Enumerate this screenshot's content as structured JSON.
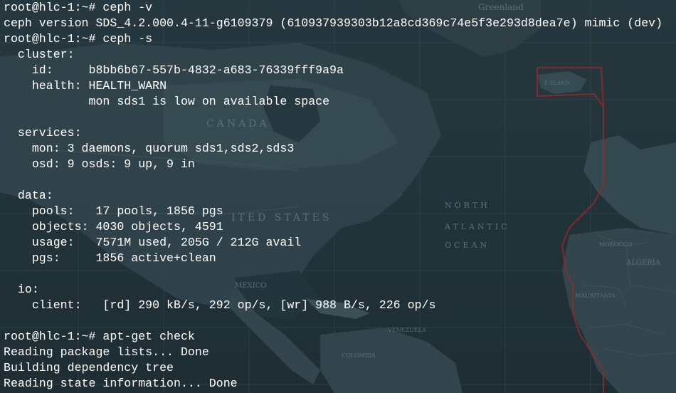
{
  "terminal": {
    "lines": [
      "root@hlc-1:~# ceph -v",
      "ceph version SDS_4.2.000.4-11-g6109379 (610937939303b12a8cd369c74e5f3e293d8dea7e) mimic (dev)",
      "root@hlc-1:~# ceph -s",
      "  cluster:",
      "    id:     b8bb6b67-557b-4832-a683-76339fff9a9a",
      "    health: HEALTH_WARN",
      "            mon sds1 is low on available space",
      "",
      "  services:",
      "    mon: 3 daemons, quorum sds1,sds2,sds3",
      "    osd: 9 osds: 9 up, 9 in",
      "",
      "  data:",
      "    pools:   17 pools, 1856 pgs",
      "    objects: 4030 objects, 4591",
      "    usage:   7571M used, 205G / 212G avail",
      "    pgs:     1856 active+clean",
      "",
      "  io:",
      "    client:   [rd] 290 kB/s, 292 op/s, [wr] 988 B/s, 226 op/s",
      "",
      "root@hlc-1:~# apt-get check",
      "Reading package lists... Done",
      "Building dependency tree",
      "Reading state information... Done"
    ]
  },
  "background_map": {
    "labels": {
      "greenland": "Greenland",
      "canada": "CANADA",
      "united_states": "ITED STATES",
      "north": "NORTH",
      "atlantic": "ATLANTIC",
      "ocean": "OCEAN",
      "mexico": "MEXICO",
      "algeria": "ALGERIA",
      "morocco": "MOROCCO",
      "mauritania": "MAURITANIA",
      "venezuela": "VENEZUELA",
      "colombia": "COLOMBIA",
      "iceland": "ICELAND"
    },
    "colors": {
      "ocean": "#263840",
      "land": "#3a4e57",
      "land_light": "#455a63",
      "grid": "#3d5058",
      "route": "#b02a2a",
      "label": "#6f8790"
    }
  }
}
